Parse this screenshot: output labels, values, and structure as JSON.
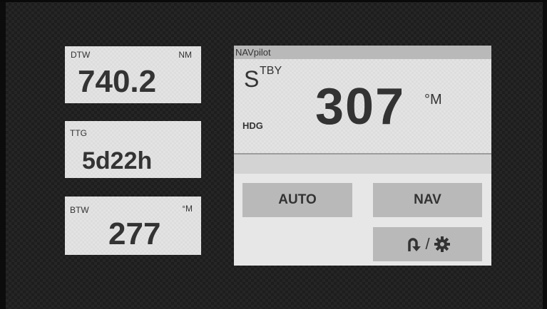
{
  "left_tiles": {
    "dtw": {
      "label": "DTW",
      "unit": "NM",
      "value": "740.2"
    },
    "ttg": {
      "label": "TTG",
      "value": "5d22h"
    },
    "btw": {
      "label": "BTW",
      "unit": "°M",
      "value": "277"
    }
  },
  "pilot": {
    "title": "NAVpilot",
    "mode_big": "S",
    "mode_rest": "TBY",
    "heading_label": "HDG",
    "heading_value": "307",
    "heading_unit": "°M",
    "buttons": {
      "auto": "AUTO",
      "nav": "NAV",
      "separator": "/"
    },
    "icons": [
      "u-turn-icon",
      "gear-icon"
    ]
  }
}
